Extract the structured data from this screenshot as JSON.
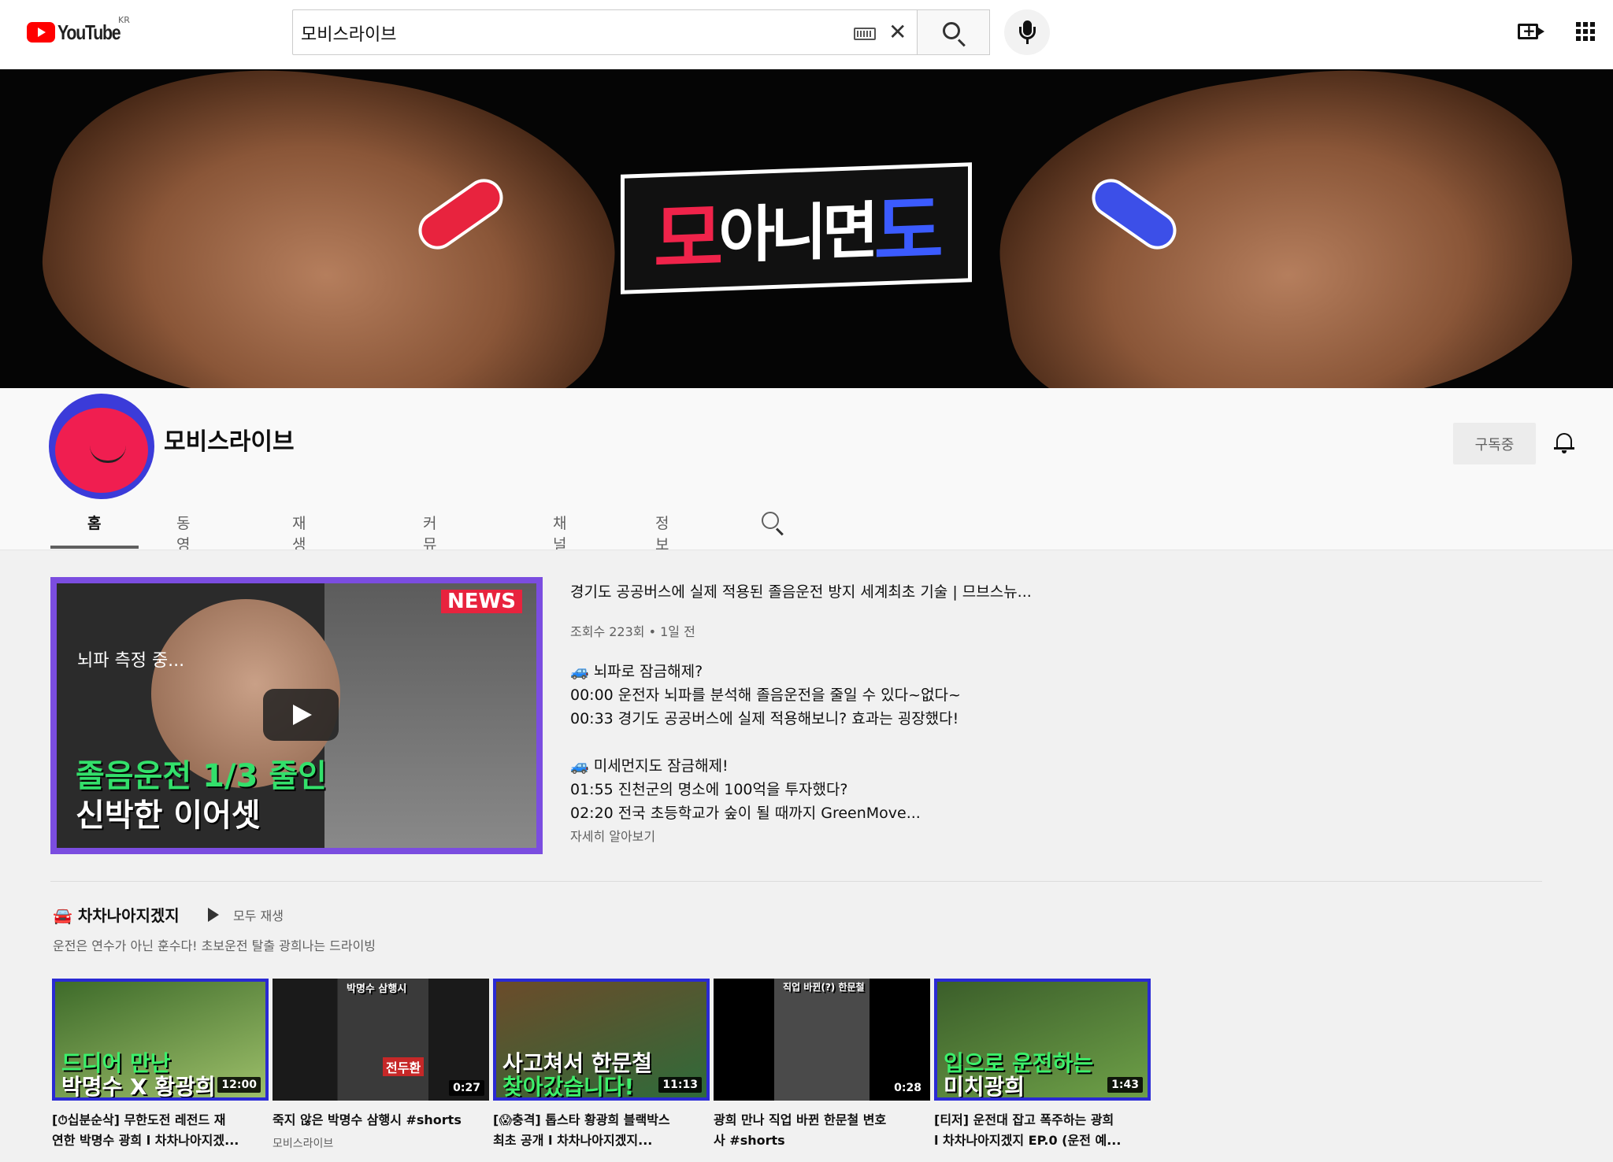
{
  "topbar": {
    "logo_text": "YouTube",
    "country_code": "KR",
    "search_value": "모비스라이브"
  },
  "banner": {
    "title_red": "모",
    "title_white": "아니면",
    "title_blue": "도"
  },
  "channel": {
    "name": "모비스라이브",
    "subscribe_label": "구독중"
  },
  "tabs": [
    "홈",
    "동영상",
    "재생목록",
    "커뮤니티",
    "채널",
    "정보"
  ],
  "featured": {
    "thumb_badge": "NEWS",
    "thumb_caption_top": "뇌파 측정 중...",
    "thumb_caption_green": "졸음운전 1/3 줄인",
    "thumb_caption_white": "신박한 이어셋",
    "title": "경기도 공공버스에 실제 적용된 졸음운전 방지 세계최초 기술 | 므브스뉴...",
    "meta": "조회수 223회 • 1일 전",
    "description": "🚙 뇌파로 잠금해제?\n00:00 운전자 뇌파를 분석해 졸음운전을 줄일 수 있다~없다~\n00:33 경기도 공공버스에 실제 적용해보니? 효과는 굉장했다!\n\n🚙 미세먼지도 잠금해제!\n01:55 진천군의 명소에 100억을 투자했다?\n02:20 전국 초등학교가 숲이 될 때까지 GreenMove...",
    "more_label": "자세히 알아보기"
  },
  "playlist": {
    "title": "🚘 차차나아지겠지",
    "play_all": "모두 재생",
    "subtitle": "운전은 연수가 아닌 훈수다! 초보운전 탈출 광희나는 드라이빙",
    "videos": [
      {
        "cap1": "드디어 만난",
        "cap2": "박명수 X 황광희",
        "duration": "12:00",
        "title": "[⏱십분순삭] 무한도전 레전드 재\n연한 박명수 광희 l 차차나아지겠...",
        "channel": ""
      },
      {
        "cap1": "박명수 삼행시",
        "cap2": "전두환",
        "duration": "0:27",
        "title": "죽지 않은 박명수 삼행시 #shorts",
        "channel": "모비스라이브"
      },
      {
        "cap1": "사고쳐서 한문철",
        "cap2": "찾아갔습니다!",
        "duration": "11:13",
        "title": "[😱충격] 톱스타 황광희 블랙박스\n최초 공개 l 차차나아지겠지...",
        "channel": ""
      },
      {
        "cap1": "직업 바뀐(?) 한문철",
        "cap2": "",
        "duration": "0:28",
        "title": "광희 만나 직업 바뀐 한문철 변호\n사 #shorts",
        "channel": ""
      },
      {
        "cap1": "입으로 운전하는",
        "cap2": "미치광희",
        "duration": "1:43",
        "title": "[티저] 운전대 잡고 폭주하는 광희\nl 차차나아지겠지 EP.0 (운전 예...",
        "channel": ""
      }
    ]
  }
}
